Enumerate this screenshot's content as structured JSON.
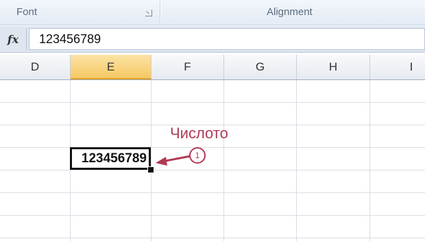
{
  "ribbon": {
    "groups": [
      {
        "label": "Font"
      },
      {
        "label": "Alignment"
      }
    ]
  },
  "formula_bar": {
    "fx_label": "fx",
    "value": "123456789"
  },
  "columns": [
    "D",
    "E",
    "F",
    "G",
    "H",
    "I"
  ],
  "selected_column": "E",
  "active_cell": {
    "value": "123456789"
  },
  "annotation": {
    "label": "Числото",
    "badge": "1",
    "color": "#b03a55"
  }
}
